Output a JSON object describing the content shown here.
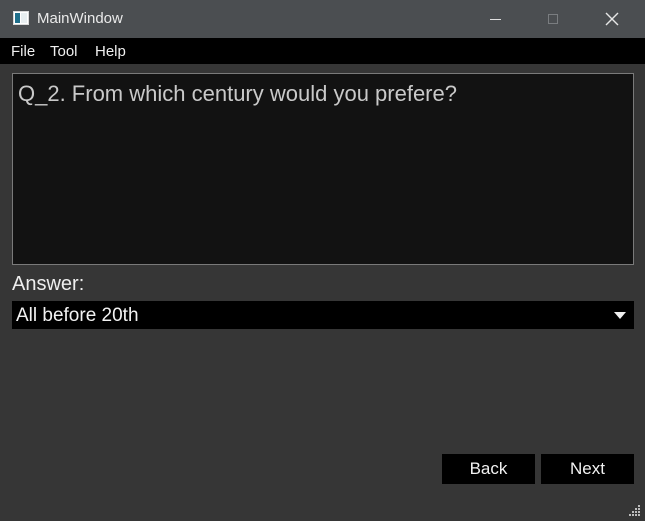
{
  "window": {
    "title": "MainWindow"
  },
  "menu": {
    "file": "File",
    "tool": "Tool",
    "help": "Help"
  },
  "question": {
    "text": "Q_2. From which century would you prefere?"
  },
  "answer": {
    "label": "Answer:",
    "selected": "All before 20th"
  },
  "buttons": {
    "back": "Back",
    "next": "Next"
  },
  "colors": {
    "titlebar": "#4b4e51",
    "background": "#363636",
    "menubar": "#000000",
    "question_bg": "#121212"
  }
}
